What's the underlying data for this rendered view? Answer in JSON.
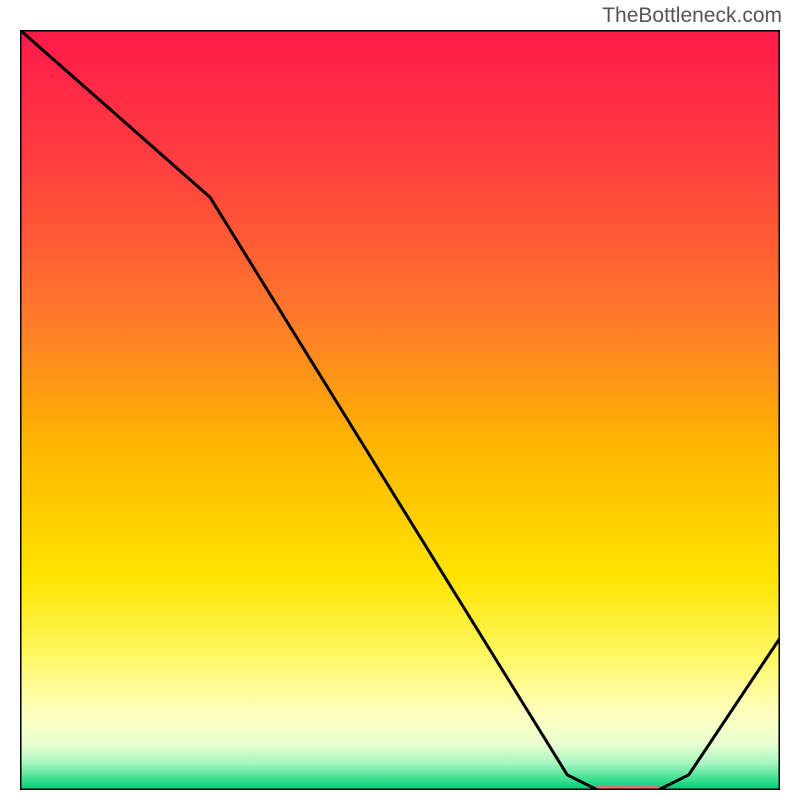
{
  "watermark": "TheBottleneck.com",
  "chart_data": {
    "type": "line",
    "title": "",
    "xlabel": "",
    "ylabel": "",
    "xlim": [
      0,
      100
    ],
    "ylim": [
      0,
      100
    ],
    "x": [
      0,
      25,
      72,
      76,
      84,
      88,
      100
    ],
    "values": [
      100,
      78,
      2,
      0,
      0,
      2,
      20
    ],
    "background_gradient": {
      "stops": [
        {
          "offset": 0.0,
          "color": "#ff1a4a"
        },
        {
          "offset": 0.18,
          "color": "#ff3f3f"
        },
        {
          "offset": 0.38,
          "color": "#ff7a2a"
        },
        {
          "offset": 0.55,
          "color": "#ffb600"
        },
        {
          "offset": 0.72,
          "color": "#ffe400"
        },
        {
          "offset": 0.82,
          "color": "#fff760"
        },
        {
          "offset": 0.9,
          "color": "#ffffc0"
        },
        {
          "offset": 0.94,
          "color": "#e8ffd0"
        },
        {
          "offset": 0.965,
          "color": "#a8f5c0"
        },
        {
          "offset": 0.985,
          "color": "#40e090"
        },
        {
          "offset": 1.0,
          "color": "#00cc7a"
        }
      ]
    },
    "flat_region_marker": {
      "x_start": 76,
      "x_end": 84,
      "color": "#e57373",
      "thickness": 4
    },
    "border_color": "#000000",
    "line_color": "#000000"
  }
}
